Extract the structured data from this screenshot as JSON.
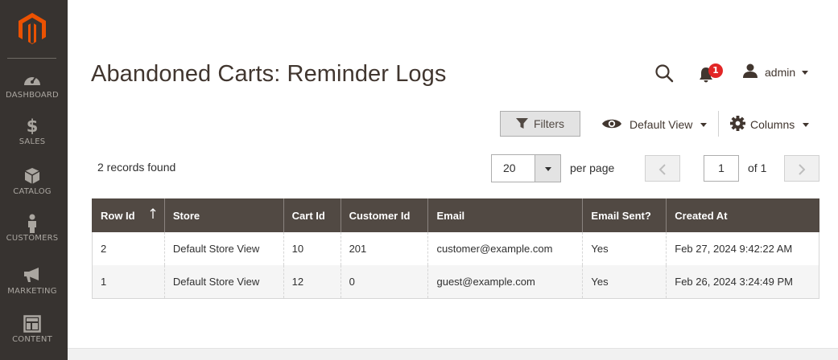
{
  "sidebar": {
    "items": [
      {
        "label": "DASHBOARD",
        "icon": "dashboard-icon"
      },
      {
        "label": "SALES",
        "icon": "dollar-icon"
      },
      {
        "label": "CATALOG",
        "icon": "box-icon"
      },
      {
        "label": "CUSTOMERS",
        "icon": "person-icon"
      },
      {
        "label": "MARKETING",
        "icon": "megaphone-icon"
      },
      {
        "label": "CONTENT",
        "icon": "layout-icon"
      }
    ]
  },
  "header": {
    "title": "Abandoned Carts: Reminder Logs",
    "notification_count": "1",
    "admin_label": "admin"
  },
  "toolbar": {
    "filters_label": "Filters",
    "view_label": "Default View",
    "columns_label": "Columns"
  },
  "grid_info": {
    "records_found": "2 records found",
    "per_page_value": "20",
    "per_page_label": "per page",
    "current_page": "1",
    "total_pages_label": "of 1"
  },
  "table": {
    "columns": [
      "Row Id",
      "Store",
      "Cart Id",
      "Customer Id",
      "Email",
      "Email Sent?",
      "Created At"
    ],
    "rows": [
      [
        "2",
        "Default Store View",
        "10",
        "201",
        "customer@example.com",
        "Yes",
        "Feb 27, 2024 9:42:22 AM"
      ],
      [
        "1",
        "Default Store View",
        "12",
        "0",
        "guest@example.com",
        "Yes",
        "Feb 26, 2024 3:24:49 PM"
      ]
    ]
  },
  "colors": {
    "sidebar_bg": "#373330",
    "brand_orange": "#eb5202",
    "table_header_bg": "#514943",
    "badge_red": "#e22626"
  }
}
